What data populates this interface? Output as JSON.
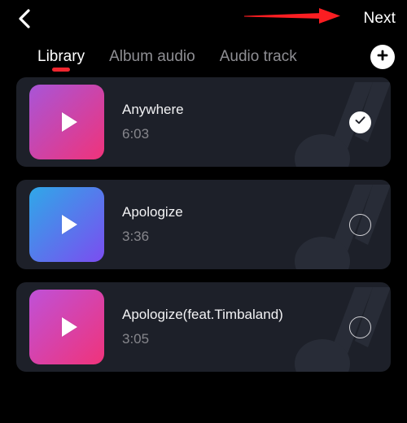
{
  "header": {
    "back_icon": "chevron-left-icon",
    "next_label": "Next",
    "annotation_arrow": {
      "icon": "red-arrow-annotation",
      "color": "#fb1e22",
      "points_to": "Next"
    }
  },
  "tabs": {
    "items": [
      {
        "label": "Library",
        "active": true
      },
      {
        "label": "Album audio",
        "active": false
      },
      {
        "label": "Audio track",
        "active": false
      }
    ],
    "indicator_color": "#f0262f",
    "add_button": {
      "icon": "plus-icon",
      "label": "+"
    }
  },
  "colors": {
    "page_background": "#000000",
    "card_background": "#1d2029",
    "active_tab_text": "#ffffff",
    "inactive_tab_text": "#8e8e93",
    "title_text": "#f2f2f4",
    "duration_text": "#86868c",
    "accent_red": "#f0262f"
  },
  "tracks": [
    {
      "title": "Anywhere",
      "duration": "6:03",
      "selected": true,
      "select_icon": "check-circle-icon",
      "play_icon": "play-icon",
      "thumb_gradient_from": "#a855d8",
      "thumb_gradient_to": "#f0337a"
    },
    {
      "title": "Apologize",
      "duration": "3:36",
      "selected": false,
      "select_icon": "radio-empty-icon",
      "play_icon": "play-icon",
      "thumb_gradient_from": "#2fa8e8",
      "thumb_gradient_to": "#7b4df0"
    },
    {
      "title": "Apologize(feat.Timbaland)",
      "duration": "3:05",
      "selected": false,
      "select_icon": "radio-empty-icon",
      "play_icon": "play-icon",
      "thumb_gradient_from": "#bf51d8",
      "thumb_gradient_to": "#f0337a"
    }
  ]
}
